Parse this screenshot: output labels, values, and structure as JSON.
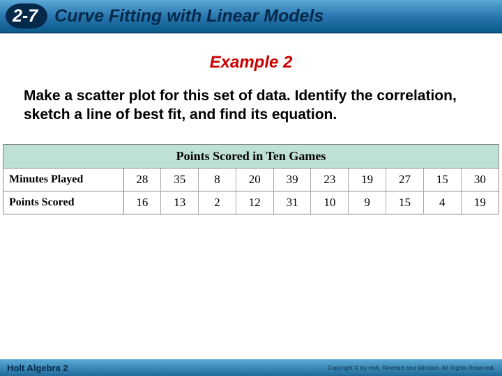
{
  "header": {
    "lesson_number": "2-7",
    "lesson_title": "Curve Fitting with Linear Models"
  },
  "example_heading": "Example 2",
  "instruction": "Make a scatter plot for this set of data. Identify the correlation, sketch a line of best fit, and find its equation.",
  "table": {
    "title": "Points Scored in Ten Games",
    "rows": [
      {
        "label": "Minutes Played",
        "values": [
          28,
          35,
          8,
          20,
          39,
          23,
          19,
          27,
          15,
          30
        ]
      },
      {
        "label": "Points Scored",
        "values": [
          16,
          13,
          2,
          12,
          31,
          10,
          9,
          15,
          4,
          19
        ]
      }
    ]
  },
  "footer": {
    "left": "Holt Algebra 2",
    "right": "Copyright © by Holt, Rinehart and Winston. All Rights Reserved."
  }
}
